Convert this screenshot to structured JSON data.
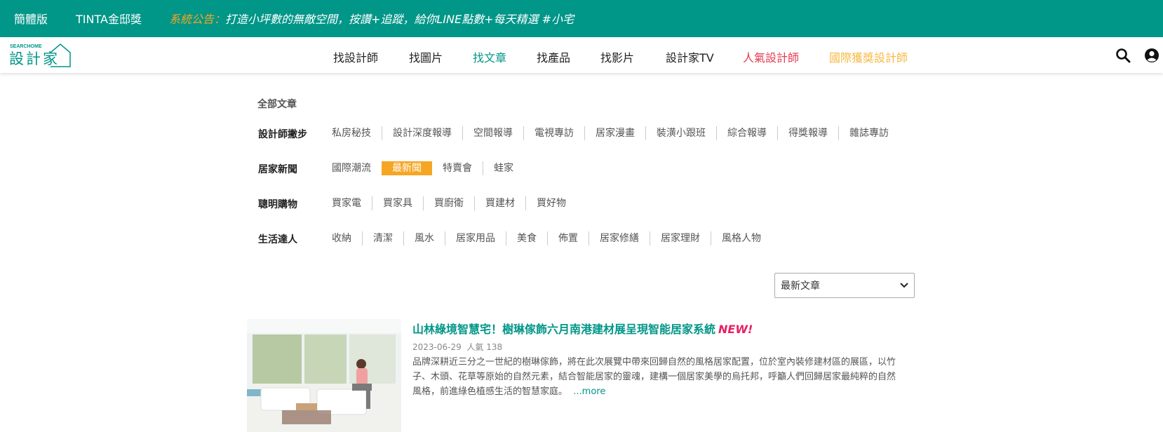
{
  "topbar": {
    "simplified_label": "簡體版",
    "tinta_label": "TINTA金邸獎",
    "announce_label": "系統公告：",
    "announce_text": "打造小坪數的無敵空間，按讚+追蹤，給你LINE點數+每天精選 #小宅"
  },
  "logo": {
    "small_text": "SEARCHOME",
    "main_text": "設計家"
  },
  "nav": {
    "items": [
      {
        "label": "找設計師",
        "color": "#222222"
      },
      {
        "label": "找圖片",
        "color": "#222222"
      },
      {
        "label": "找文章",
        "color": "#009688"
      },
      {
        "label": "找產品",
        "color": "#222222"
      },
      {
        "label": "找影片",
        "color": "#222222"
      },
      {
        "label": "設計家TV",
        "color": "#222222"
      },
      {
        "label": "人氣設計師",
        "color": "#e53950"
      },
      {
        "label": "國際獲獎設計師",
        "color": "#f5b942"
      }
    ],
    "icons": [
      "search-icon",
      "user-icon"
    ]
  },
  "filters": {
    "all_label": "全部文章",
    "rows": [
      {
        "title": "設計師撇步",
        "items": [
          "私房秘技",
          "設計深度報導",
          "空間報導",
          "電視專訪",
          "居家漫畫",
          "裝潢小跟班",
          "綜合報導",
          "得獎報導",
          "雜誌專訪"
        ]
      },
      {
        "title": "居家新聞",
        "items": [
          "國際潮流",
          "最新聞",
          "特賣會",
          "蛙家"
        ],
        "active": "最新聞"
      },
      {
        "title": "聰明購物",
        "items": [
          "買家電",
          "買家具",
          "買廚衛",
          "買建材",
          "買好物"
        ]
      },
      {
        "title": "生活達人",
        "items": [
          "收納",
          "清潔",
          "風水",
          "居家用品",
          "美食",
          "佈置",
          "居家修繕",
          "居家理財",
          "風格人物"
        ]
      }
    ]
  },
  "sort": {
    "selected": "最新文章"
  },
  "article": {
    "title": "山林綠境智慧宅！樹琳傢飾六月南港建材展呈現智能居家系統",
    "new_badge": "NEW!",
    "date": "2023-06-29",
    "popularity": "人氣 138",
    "excerpt": "品牌深耕近三分之一世紀的樹琳傢飾，將在此次展覽中帶來回歸自然的風格居家配置，位於室內裝修建材區的展區，以竹子、木頭、花草等原始的自然元素，結合智能居家的靈魂，建構一個居家美學的烏托邦，呼籲人們回歸居家最純粹的自然風格，前進綠色植感生活的智慧家庭。",
    "more_label": "...more"
  },
  "colors": {
    "brand": "#009688",
    "accent": "#f5a623",
    "new": "#e91e63"
  }
}
